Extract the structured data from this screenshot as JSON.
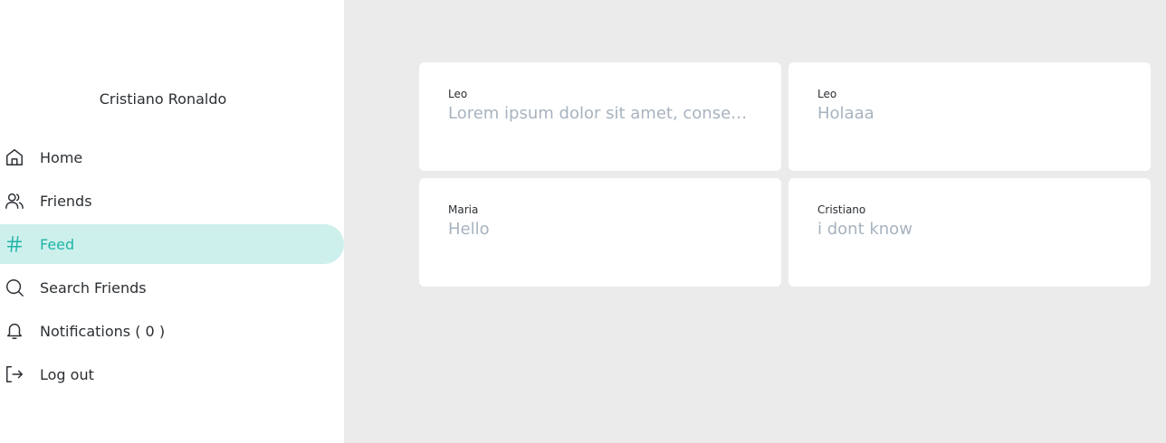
{
  "sidebar": {
    "user_name": "Cristiano Ronaldo",
    "accent_color": "#1fb5a6",
    "active_bg": "#cdf0ed",
    "items": [
      {
        "label": "Home",
        "icon": "home-icon"
      },
      {
        "label": "Friends",
        "icon": "friends-icon"
      },
      {
        "label": "Feed",
        "icon": "hash-icon",
        "active": true
      },
      {
        "label": "Search Friends",
        "icon": "search-icon"
      },
      {
        "label": "Notifications ( 0 )",
        "icon": "bell-icon"
      },
      {
        "label": "Log out",
        "icon": "logout-icon"
      }
    ]
  },
  "feed": {
    "posts": [
      {
        "author": "Leo",
        "text": "Lorem ipsum dolor sit amet, consectetur adipiscing elit"
      },
      {
        "author": "Leo",
        "text": "Holaaa"
      },
      {
        "author": "Maria",
        "text": "Hello"
      },
      {
        "author": "Cristiano",
        "text": "i dont know"
      }
    ]
  }
}
